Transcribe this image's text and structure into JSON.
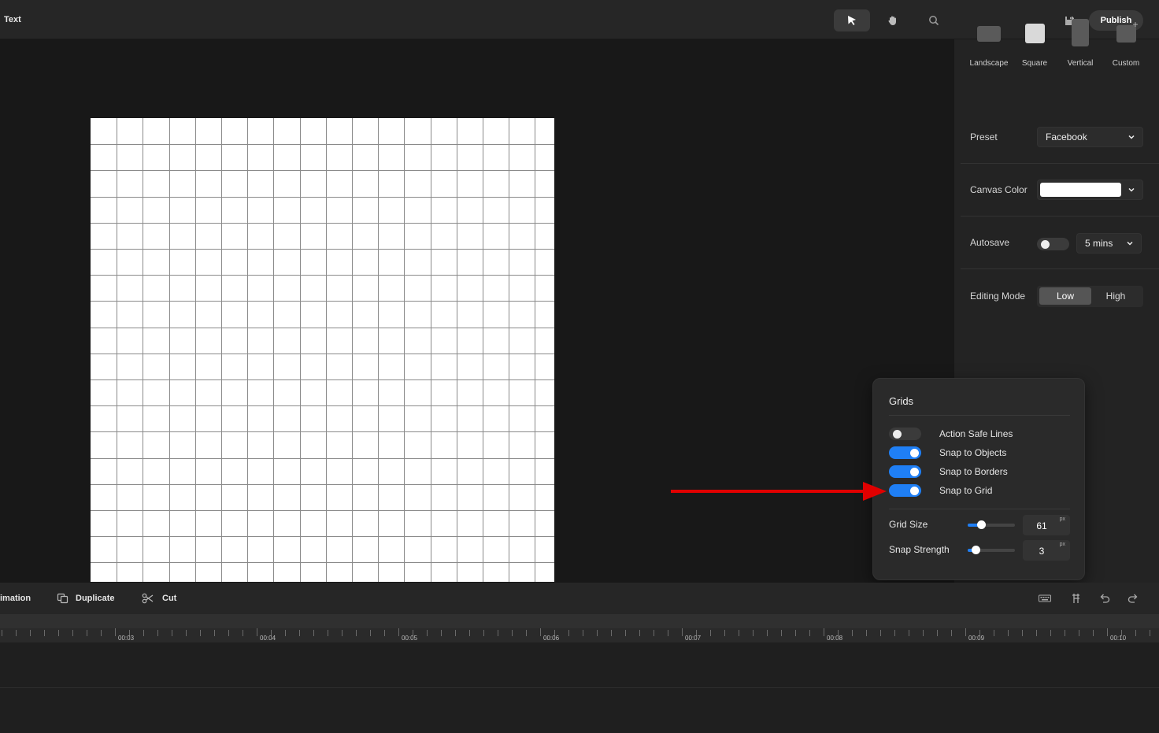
{
  "app": {
    "title": "Text"
  },
  "toolbar": {
    "tools": [
      {
        "icon": "pointer-icon",
        "active": true
      },
      {
        "icon": "hand-icon",
        "active": false
      },
      {
        "icon": "zoom-icon",
        "active": false
      }
    ],
    "save_icon": "save-icon",
    "publish_label": "Publish"
  },
  "panel": {
    "ratios": [
      {
        "label": "Landscape",
        "icon": "landscape-icon"
      },
      {
        "label": "Square",
        "icon": "square-icon"
      },
      {
        "label": "Vertical",
        "icon": "vertical-icon"
      },
      {
        "label": "Custom",
        "icon": "custom-icon"
      }
    ],
    "preset_label": "Preset",
    "preset_value": "Facebook",
    "canvas_color_label": "Canvas Color",
    "canvas_color": "#ffffff",
    "autosave_label": "Autosave",
    "autosave_on": false,
    "autosave_interval": "5 mins",
    "editing_mode_label": "Editing Mode",
    "editing_modes": [
      "Low",
      "High"
    ],
    "editing_mode_selected": "Low"
  },
  "grids": {
    "title": "Grids",
    "toggles": [
      {
        "label": "Action Safe Lines",
        "on": false
      },
      {
        "label": "Snap to Objects",
        "on": true
      },
      {
        "label": "Snap to Borders",
        "on": true
      },
      {
        "label": "Snap to Grid",
        "on": true
      }
    ],
    "grid_size_label": "Grid Size",
    "grid_size": "61",
    "grid_size_level": 0.25,
    "snap_strength_label": "Snap Strength",
    "snap_strength": "3",
    "snap_strength_level": 0.13,
    "unit": "px"
  },
  "bottom": {
    "animation_label": "imation",
    "duplicate_label": "Duplicate",
    "cut_label": "Cut"
  },
  "timeline": {
    "ticks": [
      "00:03",
      "00:04",
      "00:05",
      "00:06",
      "00:07",
      "00:08",
      "00:09",
      "00:10"
    ]
  },
  "colors": {
    "accent": "#1f7ff5",
    "annotation_arrow": "#e00000"
  }
}
